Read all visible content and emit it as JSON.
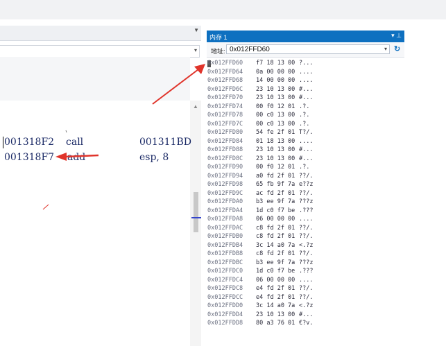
{
  "left_panel": {
    "code_lines": [
      {
        "addr": "001318F2",
        "mnemonic": "call",
        "operand": "001311BD"
      },
      {
        "addr": "001318F7",
        "mnemonic": "add",
        "operand": "esp, 8"
      }
    ]
  },
  "memory_window": {
    "title": "内存 1",
    "address_label": "地址:",
    "address_value": "0x012FFD60",
    "rows": [
      {
        "addr": "0x012FFD60",
        "bytes": "f7 18 13 00",
        "ascii": "?..."
      },
      {
        "addr": "0x012FFD64",
        "bytes": "0a 00 00 00",
        "ascii": "...."
      },
      {
        "addr": "0x012FFD68",
        "bytes": "14 00 00 00",
        "ascii": "...."
      },
      {
        "addr": "0x012FFD6C",
        "bytes": "23 10 13 00",
        "ascii": "#..."
      },
      {
        "addr": "0x012FFD70",
        "bytes": "23 10 13 00",
        "ascii": "#..."
      },
      {
        "addr": "0x012FFD74",
        "bytes": "00 f0 12 01",
        "ascii": ".?."
      },
      {
        "addr": "0x012FFD78",
        "bytes": "00 c0 13 00",
        "ascii": ".?."
      },
      {
        "addr": "0x012FFD7C",
        "bytes": "00 c0 13 00",
        "ascii": ".?."
      },
      {
        "addr": "0x012FFD80",
        "bytes": "54 fe 2f 01",
        "ascii": "T?/."
      },
      {
        "addr": "0x012FFD84",
        "bytes": "01 18 13 00",
        "ascii": "...."
      },
      {
        "addr": "0x012FFD88",
        "bytes": "23 10 13 00",
        "ascii": "#..."
      },
      {
        "addr": "0x012FFD8C",
        "bytes": "23 10 13 00",
        "ascii": "#..."
      },
      {
        "addr": "0x012FFD90",
        "bytes": "00 f0 12 01",
        "ascii": ".?."
      },
      {
        "addr": "0x012FFD94",
        "bytes": "a0 fd 2f 01",
        "ascii": "??/."
      },
      {
        "addr": "0x012FFD98",
        "bytes": "65 fb 9f 7a",
        "ascii": "e??z"
      },
      {
        "addr": "0x012FFD9C",
        "bytes": "ac fd 2f 01",
        "ascii": "??/."
      },
      {
        "addr": "0x012FFDA0",
        "bytes": "b3 ee 9f 7a",
        "ascii": "???z"
      },
      {
        "addr": "0x012FFDA4",
        "bytes": "1d c0 f7 be",
        "ascii": ".???"
      },
      {
        "addr": "0x012FFDA8",
        "bytes": "06 00 00 00",
        "ascii": "...."
      },
      {
        "addr": "0x012FFDAC",
        "bytes": "c8 fd 2f 01",
        "ascii": "??/."
      },
      {
        "addr": "0x012FFDB0",
        "bytes": "c8 fd 2f 01",
        "ascii": "??/."
      },
      {
        "addr": "0x012FFDB4",
        "bytes": "3c 14 a0 7a",
        "ascii": "<.?z"
      },
      {
        "addr": "0x012FFDB8",
        "bytes": "c8 fd 2f 01",
        "ascii": "??/."
      },
      {
        "addr": "0x012FFDBC",
        "bytes": "b3 ee 9f 7a",
        "ascii": "???z"
      },
      {
        "addr": "0x012FFDC0",
        "bytes": "1d c0 f7 be",
        "ascii": ".???"
      },
      {
        "addr": "0x012FFDC4",
        "bytes": "06 00 00 00",
        "ascii": "...."
      },
      {
        "addr": "0x012FFDC8",
        "bytes": "e4 fd 2f 01",
        "ascii": "??/."
      },
      {
        "addr": "0x012FFDCC",
        "bytes": "e4 fd 2f 01",
        "ascii": "??/."
      },
      {
        "addr": "0x012FFDD0",
        "bytes": "3c 14 a0 7a",
        "ascii": "<.?z"
      },
      {
        "addr": "0x012FFDD4",
        "bytes": "23 10 13 00",
        "ascii": "#..."
      },
      {
        "addr": "0x012FFDD8",
        "bytes": "80 a3 76 01",
        "ascii": "€?v."
      }
    ]
  },
  "colors": {
    "title_bar": "#0e70c0",
    "annotation_red": "#e0342b",
    "scroll_marker": "#3344cc"
  }
}
